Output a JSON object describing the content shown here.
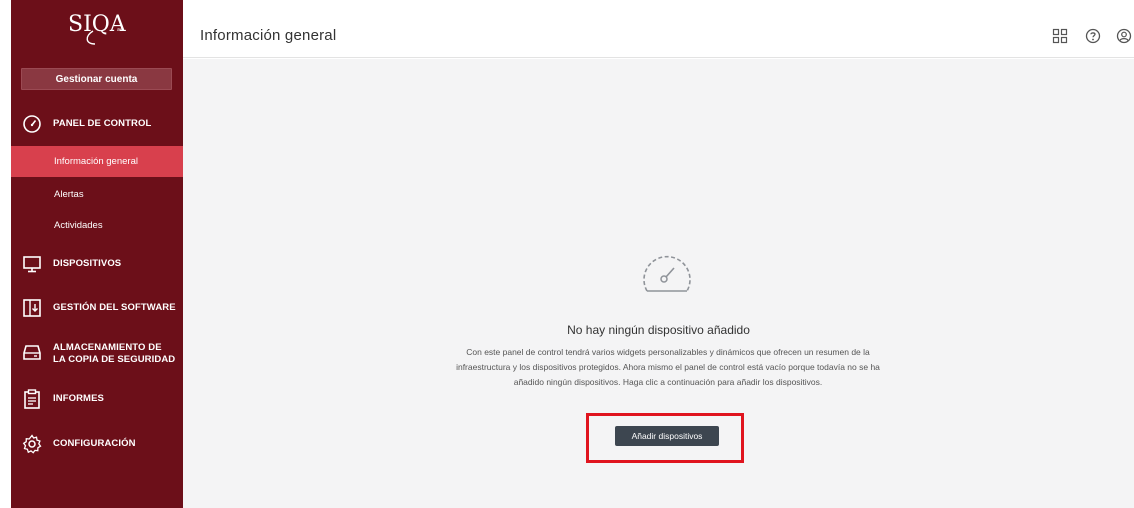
{
  "sidebar": {
    "logo_text": "SIQA",
    "manage_account": "Gestionar cuenta",
    "sections": {
      "panel": "PANEL DE CONTROL",
      "devices": "DISPOSITIVOS",
      "software": "GESTIÓN DEL SOFTWARE",
      "backup_line1": "ALMACENAMIENTO DE",
      "backup_line2": "LA COPIA DE SEGURIDAD",
      "reports": "INFORMES",
      "config": "CONFIGURACIÓN"
    },
    "sub_items": {
      "overview": "Información general",
      "alerts": "Alertas",
      "activities": "Actividades"
    }
  },
  "header": {
    "title": "Información general"
  },
  "main": {
    "empty_title": "No hay ningún dispositivo añadido",
    "empty_description": "Con este panel de control tendrá varios widgets personalizables y dinámicos que ofrecen un resumen de la infraestructura y los dispositivos protegidos. Ahora mismo el panel de control está vacío porque todavía no se ha añadido ningún dispositivos. Haga clic a continuación para añadir los dispositivos.",
    "add_button": "Añadir dispositivos"
  },
  "colors": {
    "sidebar_bg": "#6c0f19",
    "active_item": "#d8404d",
    "button_bg": "#3d4650",
    "highlight": "#e0141e"
  },
  "icons": [
    "speedometer-icon",
    "monitor-icon",
    "software-update-icon",
    "backup-drive-icon",
    "report-icon",
    "gear-icon",
    "apps-grid-icon",
    "help-icon",
    "user-account-icon"
  ]
}
